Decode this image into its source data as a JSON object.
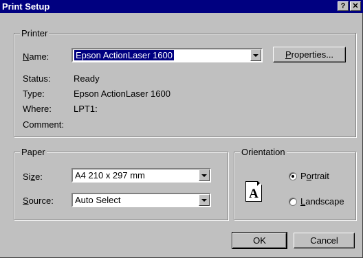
{
  "window": {
    "title": "Print Setup",
    "help_icon": "question-mark",
    "close_icon": "x"
  },
  "printer": {
    "group_label": "Printer",
    "name_label": "Name:",
    "name_accel": "N",
    "name_rest": "ame:",
    "selected_printer": "Epson ActionLaser 1600",
    "properties_accel": "P",
    "properties_rest": "roperties...",
    "status_label": "Status:",
    "status_value": "Ready",
    "type_label": "Type:",
    "type_value": "Epson ActionLaser 1600",
    "where_label": "Where:",
    "where_value": "LPT1:",
    "comment_label": "Comment:",
    "comment_value": ""
  },
  "paper": {
    "group_label": "Paper",
    "size_pre": "Si",
    "size_accel": "z",
    "size_post": "e:",
    "size_value": "A4 210 x 297 mm",
    "source_accel": "S",
    "source_rest": "ource:",
    "source_value": "Auto Select"
  },
  "orientation": {
    "group_label": "Orientation",
    "icon_letter": "A",
    "portrait_pre": "P",
    "portrait_accel": "o",
    "portrait_post": "rtrait",
    "landscape_accel": "L",
    "landscape_rest": "andscape",
    "selected": "portrait"
  },
  "buttons": {
    "ok": "OK",
    "cancel": "Cancel"
  }
}
